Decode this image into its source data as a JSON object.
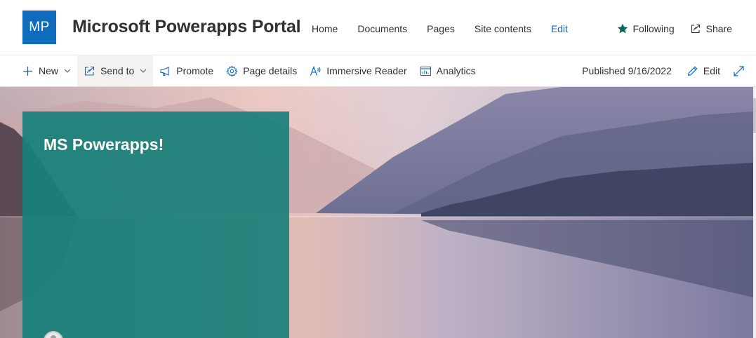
{
  "site": {
    "logo_initials": "MP",
    "title": "Microsoft Powerapps Portal",
    "nav": [
      {
        "label": "Home"
      },
      {
        "label": "Documents"
      },
      {
        "label": "Pages"
      },
      {
        "label": "Site contents"
      },
      {
        "label": "Edit"
      }
    ],
    "following_label": "Following",
    "share_label": "Share"
  },
  "command_bar": {
    "new_label": "New",
    "send_to_label": "Send to",
    "promote_label": "Promote",
    "page_details_label": "Page details",
    "immersive_reader_label": "Immersive Reader",
    "analytics_label": "Analytics",
    "published_text": "Published 9/16/2022",
    "edit_label": "Edit"
  },
  "hero": {
    "title": "MS Powerapps!"
  },
  "colors": {
    "brand": "#0f6cbd",
    "following_star": "#0b6a5e",
    "title_panel": "#19807a"
  },
  "icons": {
    "following": "star-icon",
    "share": "share-icon",
    "new": "plus-icon",
    "send_to": "send-icon",
    "promote": "megaphone-icon",
    "page_details": "gear-icon",
    "immersive_reader": "immersive-reader-icon",
    "analytics": "analytics-icon",
    "edit": "pencil-icon",
    "expand": "expand-icon"
  }
}
